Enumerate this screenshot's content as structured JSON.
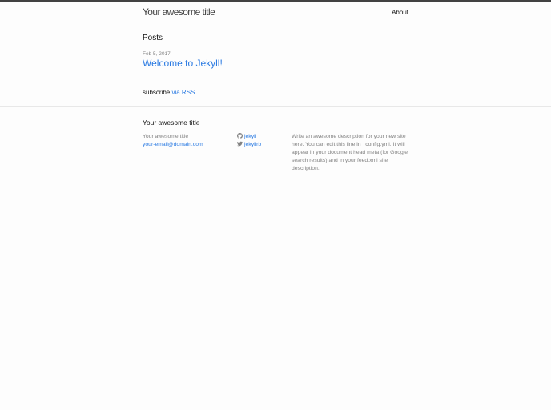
{
  "header": {
    "site_title": "Your awesome title",
    "nav": [
      {
        "label": "About"
      }
    ]
  },
  "main": {
    "heading": "Posts",
    "posts": [
      {
        "date": "Feb 5, 2017",
        "title": "Welcome to Jekyll!"
      }
    ],
    "rss": {
      "prefix": "subscribe",
      "link_label": "via RSS"
    }
  },
  "footer": {
    "heading": "Your awesome title",
    "contact": {
      "name": "Your awesome title",
      "email": "your-email@domain.com"
    },
    "social": [
      {
        "icon": "github-icon",
        "label": "jekyll"
      },
      {
        "icon": "twitter-icon",
        "label": "jekyllrb"
      }
    ],
    "description": "Write an awesome description for your new site here. You can edit this line in _config.yml. It will appear in your document head meta (for Google search results) and in your feed.xml site description."
  },
  "colors": {
    "link": "#2a7ae2",
    "meta": "#828282",
    "text": "#111111",
    "topbar": "#424242"
  }
}
